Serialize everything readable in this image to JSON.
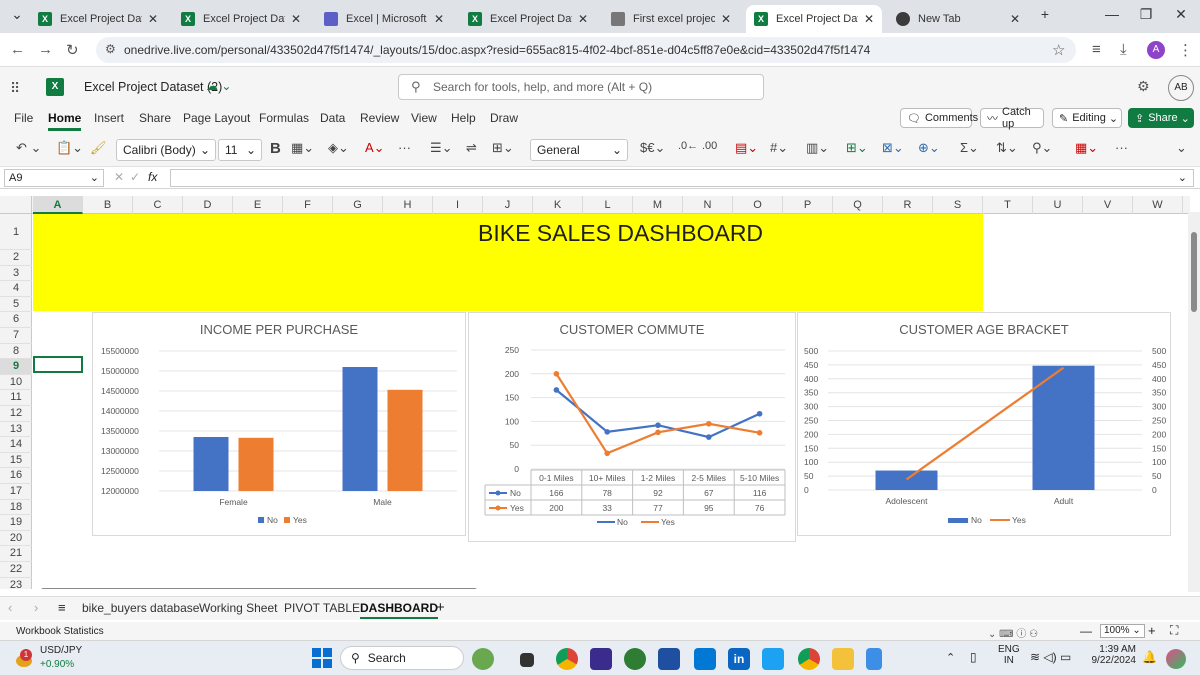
{
  "browser": {
    "tabs": [
      {
        "label": "Excel Project Dataset",
        "icon": "excel"
      },
      {
        "label": "Excel Project Dataset",
        "icon": "excel"
      },
      {
        "label": "Excel | Microsoft 365",
        "icon": "m365"
      },
      {
        "label": "Excel Project Dataset",
        "icon": "excel"
      },
      {
        "label": "First excel project.xls",
        "icon": "doc"
      },
      {
        "label": "Excel Project Dataset",
        "icon": "excel",
        "active": true
      },
      {
        "label": "New Tab",
        "icon": "chrome"
      }
    ],
    "url": "onedrive.live.com/personal/433502d47f5f1474/_layouts/15/doc.aspx?resid=655ac815-4f02-4bcf-851e-d04c5ff87e0e&cid=433502d47f5f1474",
    "profile_initial": "A"
  },
  "excel": {
    "doc_title": "Excel Project Dataset (2)",
    "search_placeholder": "Search for tools, help, and more (Alt + Q)",
    "user_initials": "AB",
    "ribbon_tabs": [
      "File",
      "Home",
      "Insert",
      "Share",
      "Page Layout",
      "Formulas",
      "Data",
      "Review",
      "View",
      "Help",
      "Draw"
    ],
    "active_tab": "Home",
    "comments_label": "Comments",
    "catchup_label": "Catch up",
    "editing_label": "Editing",
    "share_label": "Share",
    "font_name": "Calibri (Body)",
    "font_size": "11",
    "number_format": "General",
    "name_box": "A9",
    "fx_label": "fx"
  },
  "grid": {
    "columns": [
      "A",
      "B",
      "C",
      "D",
      "E",
      "F",
      "G",
      "H",
      "I",
      "J",
      "K",
      "L",
      "M",
      "N",
      "O",
      "P",
      "Q",
      "R",
      "S",
      "T",
      "U",
      "V",
      "W"
    ],
    "rows": [
      "1",
      "2",
      "3",
      "4",
      "5",
      "6",
      "7",
      "8",
      "9",
      "10",
      "11",
      "12",
      "13",
      "14",
      "15",
      "16",
      "17",
      "18",
      "19",
      "20",
      "21",
      "22",
      "23"
    ],
    "selected_col": "A",
    "selected_row": "9",
    "banner_title": "BIKE SALES DASHBOARD"
  },
  "chart_data": [
    {
      "type": "bar",
      "title": "INCOME PER PURCHASE",
      "categories": [
        "Female",
        "Male"
      ],
      "series": [
        {
          "name": "No",
          "values": [
            13350000,
            15100000
          ],
          "color": "#4472c4"
        },
        {
          "name": "Yes",
          "values": [
            13330000,
            14530000
          ],
          "color": "#ed7d31"
        }
      ],
      "yticks": [
        "15500000",
        "15000000",
        "14500000",
        "14000000",
        "13500000",
        "13000000",
        "12500000",
        "12000000"
      ],
      "ylim": [
        12000000,
        15500000
      ]
    },
    {
      "type": "line",
      "title": "CUSTOMER COMMUTE",
      "categories": [
        "0-1 Miles",
        "10+ Miles",
        "1-2 Miles",
        "2-5 Miles",
        "5-10 Miles"
      ],
      "series": [
        {
          "name": "No",
          "values": [
            166,
            78,
            92,
            67,
            116
          ],
          "color": "#4472c4"
        },
        {
          "name": "Yes",
          "values": [
            200,
            33,
            77,
            95,
            76
          ],
          "color": "#ed7d31"
        }
      ],
      "yticks": [
        "250",
        "200",
        "150",
        "100",
        "50",
        "0"
      ],
      "ylim": [
        0,
        250
      ]
    },
    {
      "type": "bar",
      "title": "CUSTOMER AGE BRACKET",
      "categories": [
        "Adolescent",
        "Adult"
      ],
      "series": [
        {
          "name": "No",
          "values": [
            70,
            447
          ],
          "color": "#4472c4"
        },
        {
          "name": "Yes",
          "values": [
            38,
            440
          ],
          "color": "#ed7d31"
        }
      ],
      "yticks": [
        "500",
        "450",
        "400",
        "350",
        "300",
        "250",
        "200",
        "150",
        "100",
        "50",
        "0"
      ],
      "ylim": [
        0,
        500
      ]
    }
  ],
  "sheets": {
    "tabs": [
      "bike_buyers database",
      "Working Sheet",
      "PIVOT TABLE",
      "DASHBOARD"
    ],
    "active": "DASHBOARD"
  },
  "status": {
    "left": "Workbook Statistics",
    "zoom": "100%"
  },
  "taskbar": {
    "ticker_name": "USD/JPY",
    "ticker_change": "+0.90%",
    "badge": "1",
    "search_label": "Search",
    "lang_1": "ENG",
    "lang_2": "IN",
    "time": "1:39 AM",
    "date": "9/22/2024"
  }
}
